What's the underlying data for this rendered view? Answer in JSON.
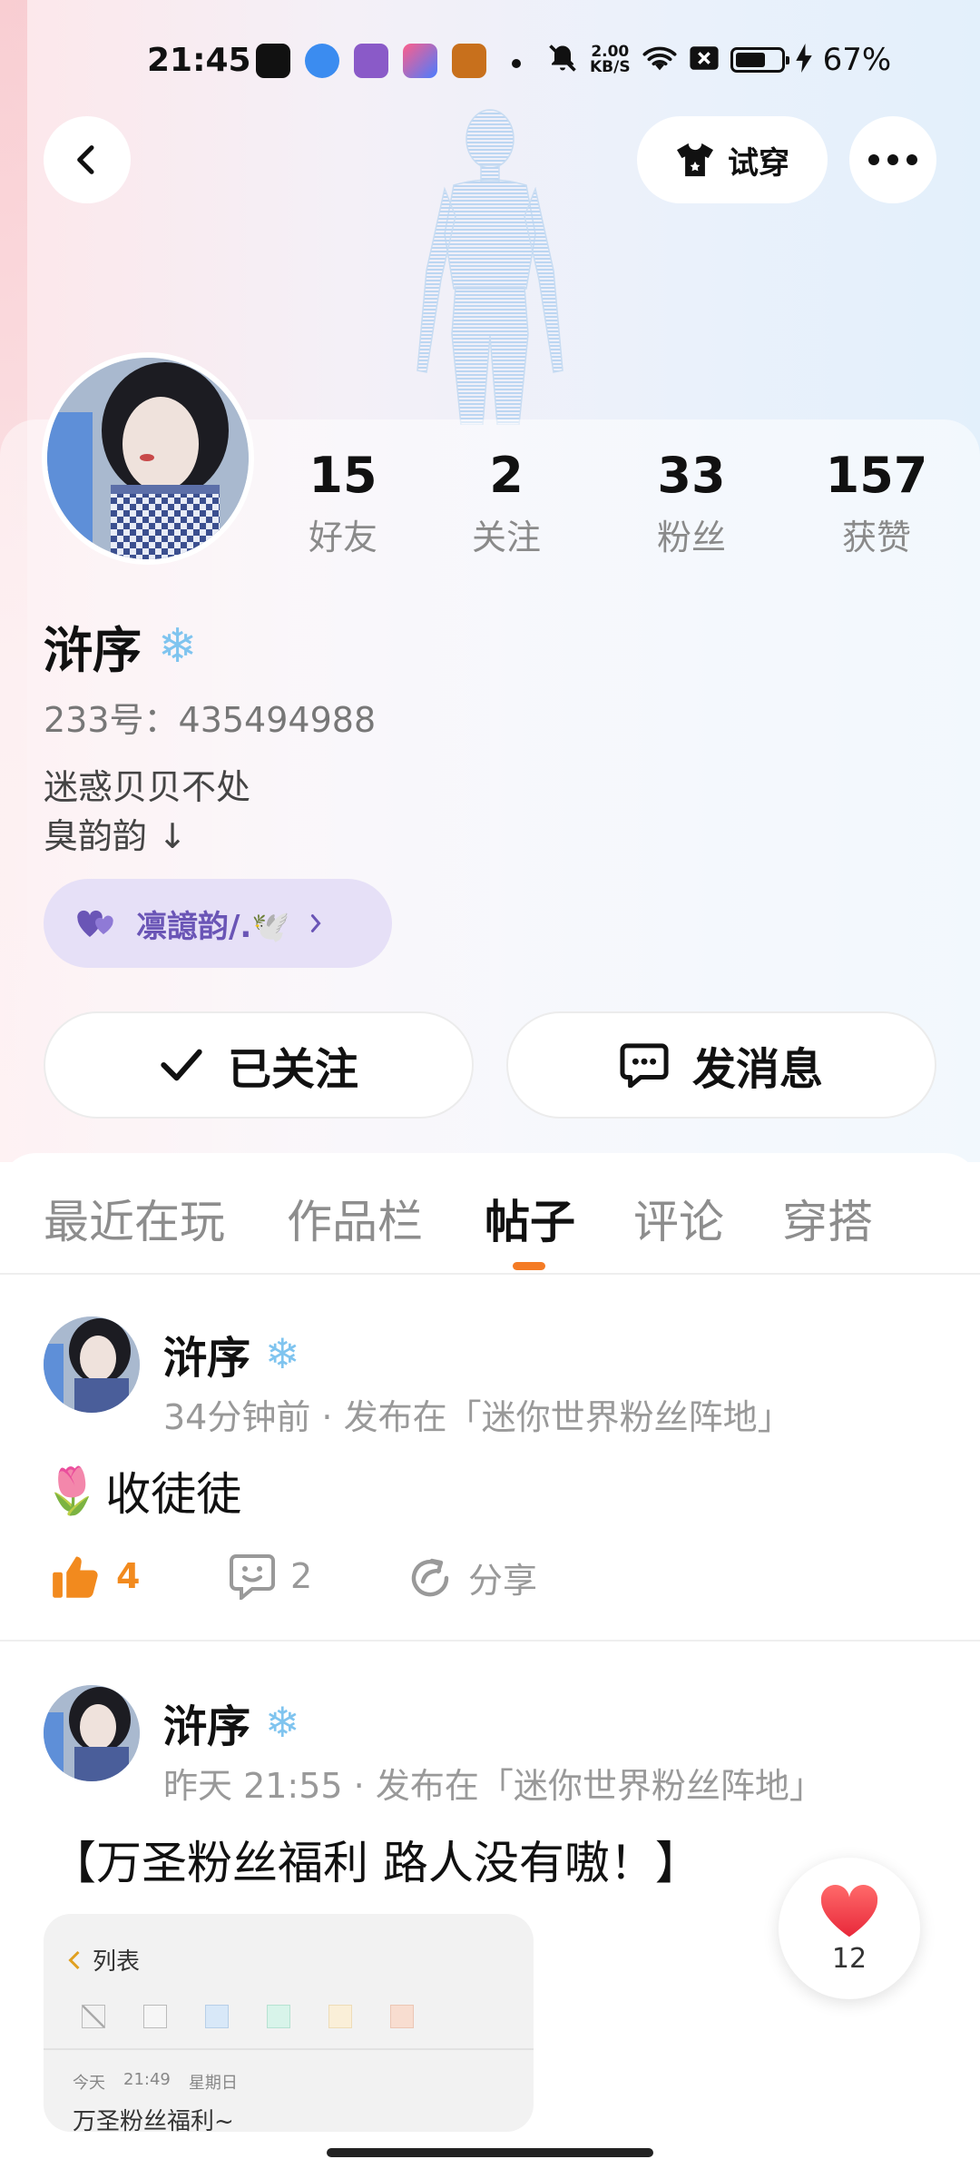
{
  "status_bar": {
    "time": "21:45",
    "net_speed_value": "2.00",
    "net_speed_unit": "KB/S",
    "battery_percent": "67%",
    "battery_level": 0.67
  },
  "header": {
    "tryon_label": "试穿"
  },
  "profile": {
    "stats": [
      {
        "value": "15",
        "label": "好友"
      },
      {
        "value": "2",
        "label": "关注"
      },
      {
        "value": "33",
        "label": "粉丝"
      },
      {
        "value": "157",
        "label": "获赞"
      }
    ],
    "name": "浒序",
    "badge": "❄",
    "id_line": "233号：435494988",
    "bio_line1": "迷惑贝贝不处",
    "bio_line2": "臭韵韵 ↓",
    "guild_label": "凛譩韵/.🕊️",
    "followed_label": "已关注",
    "message_label": "发消息"
  },
  "tabs": [
    {
      "label": "最近在玩",
      "active": false
    },
    {
      "label": "作品栏",
      "active": false
    },
    {
      "label": "帖子",
      "active": true
    },
    {
      "label": "评论",
      "active": false
    },
    {
      "label": "穿搭",
      "active": false
    }
  ],
  "posts": [
    {
      "author": "浒序",
      "badge": "❄",
      "meta": "34分钟前 · 发布在「迷你世界粉丝阵地」",
      "text": "收徒徒",
      "text_emoji": "🌷",
      "likes": "4",
      "comments": "2",
      "share_label": "分享"
    },
    {
      "author": "浒序",
      "badge": "❄",
      "meta": "昨天 21:55 · 发布在「迷你世界粉丝阵地」",
      "text": "【万圣粉丝福利  路人没有嗷！】",
      "embed": {
        "back_label": "列表",
        "date": "今天",
        "time": "21:49",
        "weekday": "星期日",
        "title": "万圣粉丝福利~"
      }
    }
  ],
  "heart_fab": {
    "count": "12"
  },
  "colors": {
    "accent_orange": "#f47b25",
    "guild_purple": "#6a55b6",
    "snow_blue": "#7fc4ef"
  }
}
